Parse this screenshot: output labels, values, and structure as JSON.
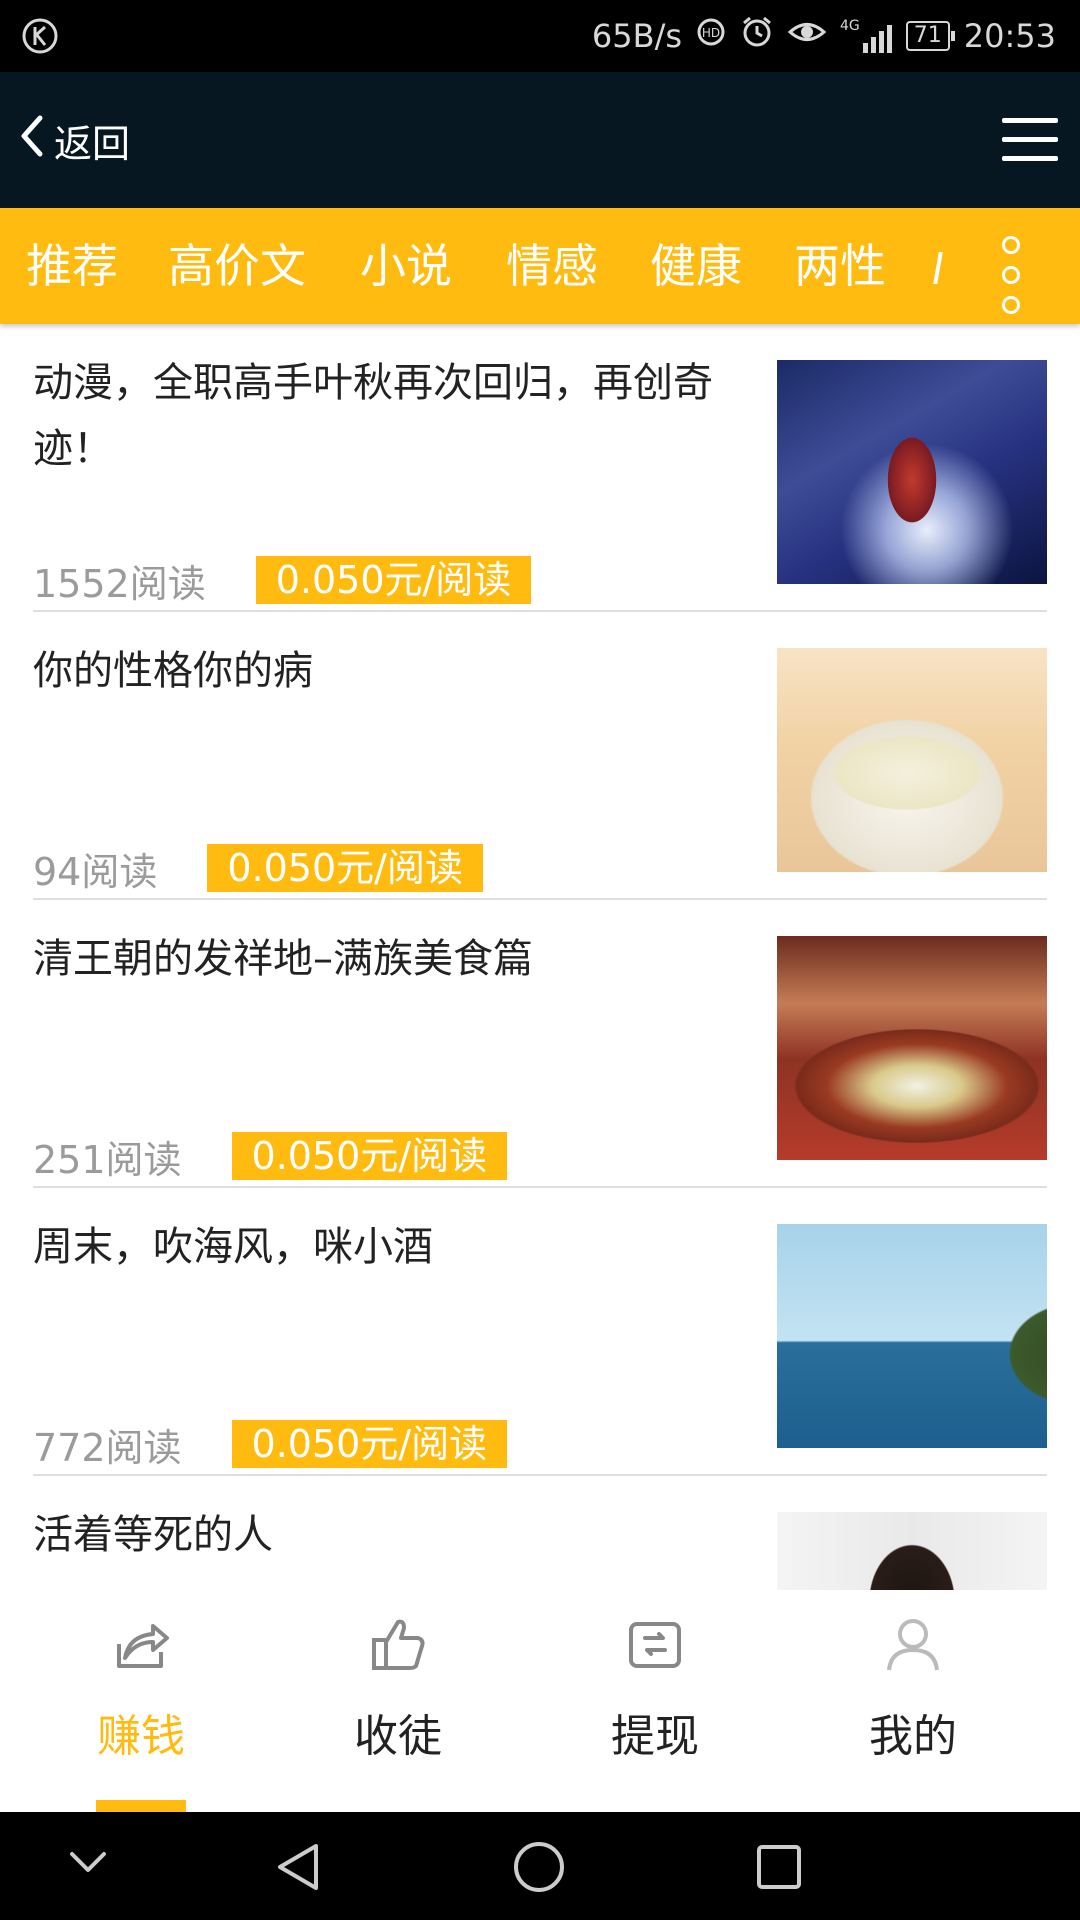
{
  "status_bar": {
    "speed": "65B/s",
    "network": "4G",
    "battery": "71",
    "time": "20:53",
    "icons": [
      "k-app-icon",
      "hd-call-icon",
      "alarm-icon",
      "eye-icon",
      "signal-icon",
      "battery-icon"
    ]
  },
  "header": {
    "back_label": "返回",
    "back_icon": "chevron-left-icon",
    "menu_icon": "hamburger-menu-icon"
  },
  "tabs": {
    "items": [
      "推荐",
      "高价文",
      "小说",
      "情感",
      "健康",
      "两性"
    ],
    "more_icon": "vertical-dots-icon",
    "accent_color": "#ffbb10"
  },
  "articles": [
    {
      "title": "动漫，全职高手叶秋再次回归，再创奇迹！",
      "reads": "1552阅读",
      "price": "0.050元/阅读"
    },
    {
      "title": "你的性格你的病",
      "reads": "94阅读",
      "price": "0.050元/阅读"
    },
    {
      "title": "清王朝的发祥地–满族美食篇",
      "reads": "251阅读",
      "price": "0.050元/阅读"
    },
    {
      "title": "周末，吹海风，咪小酒",
      "reads": "772阅读",
      "price": "0.050元/阅读"
    },
    {
      "title": "活着等死的人"
    }
  ],
  "bottom_nav": {
    "items": [
      {
        "label": "赚钱",
        "icon": "share-icon",
        "active": true
      },
      {
        "label": "收徒",
        "icon": "thumbs-up-icon",
        "active": false
      },
      {
        "label": "提现",
        "icon": "wallet-icon",
        "active": false
      },
      {
        "label": "我的",
        "icon": "user-icon",
        "active": false
      }
    ]
  },
  "system_nav": {
    "icons": [
      "chevron-down-icon",
      "back-triangle-icon",
      "home-circle-icon",
      "recents-square-icon"
    ]
  }
}
